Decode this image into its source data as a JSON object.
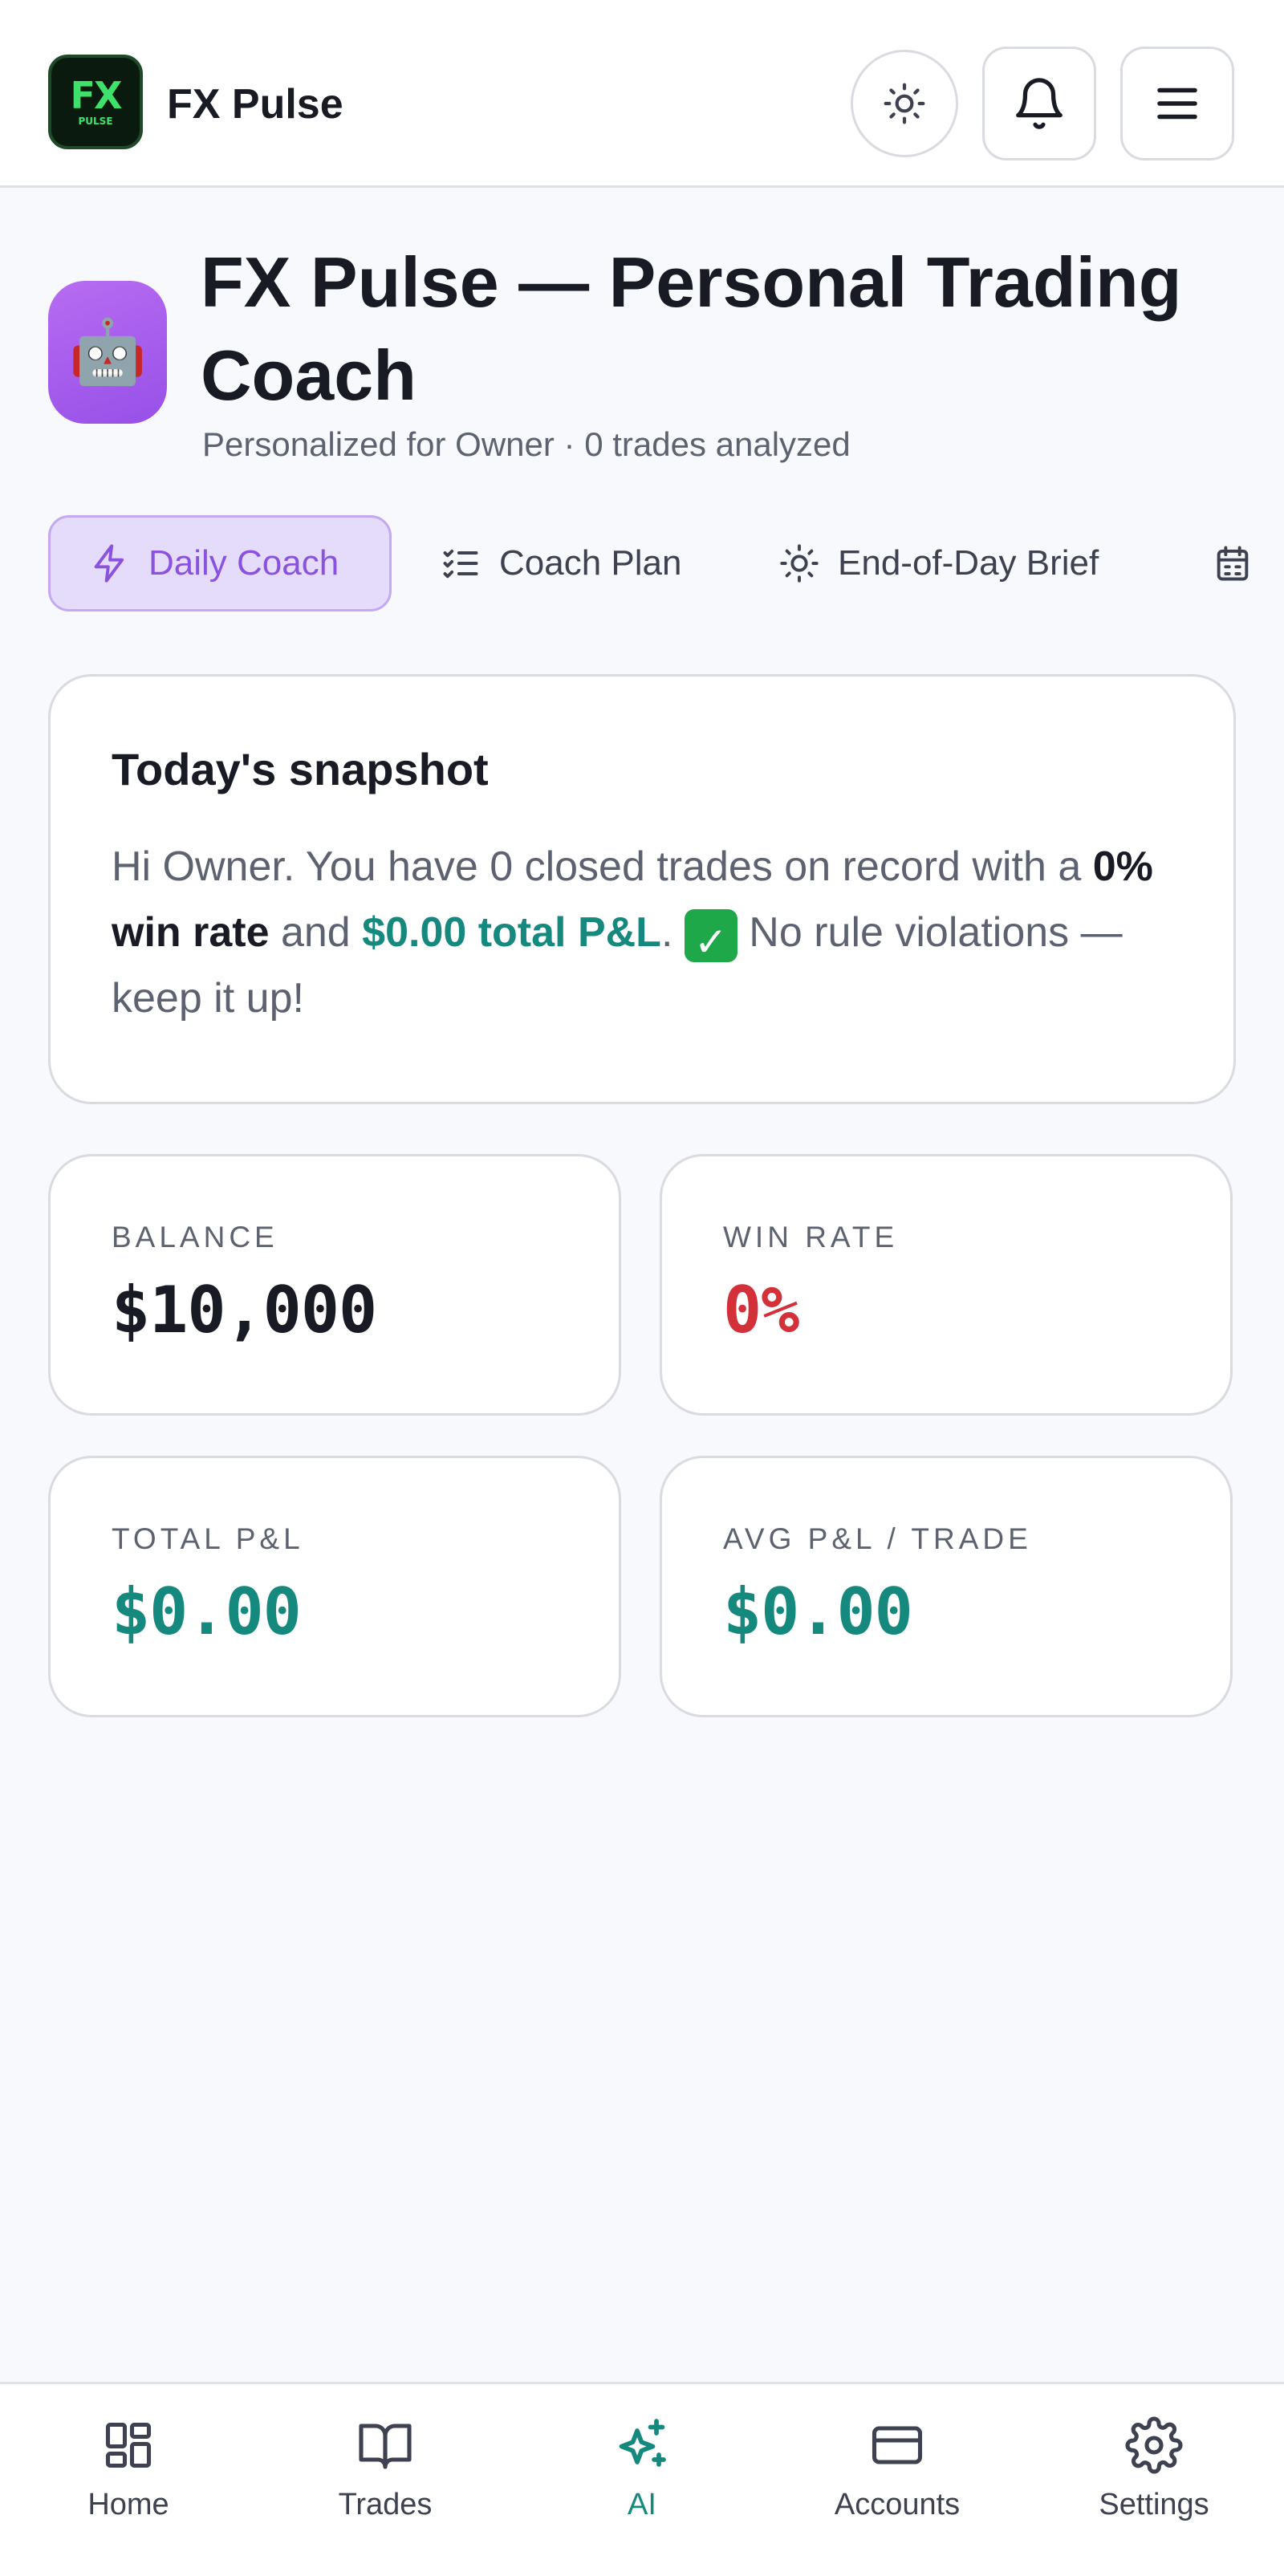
{
  "header": {
    "logo_text": "FX",
    "logo_subtext": "PULSE",
    "app_name": "FX Pulse",
    "icons": [
      "sun-icon",
      "bell-icon",
      "menu-icon"
    ]
  },
  "page": {
    "avatar_emoji": "🤖",
    "title": "FX Pulse — Personal Trading Coach",
    "subtitle": "Personalized for Owner · 0 trades analyzed"
  },
  "tabs": [
    {
      "label": "Daily Coach",
      "icon": "bolt-icon",
      "active": true
    },
    {
      "label": "Coach Plan",
      "icon": "checklist-icon",
      "active": false
    },
    {
      "label": "End-of-Day Brief",
      "icon": "sun-icon",
      "active": false
    },
    {
      "label": "",
      "icon": "calendar-icon",
      "active": false
    }
  ],
  "snapshot": {
    "title": "Today's snapshot",
    "text_1": "Hi Owner. You have 0 closed trades on record with a ",
    "win_rate_text": "0% win rate",
    "text_2": " and ",
    "pnl_text": "$0.00 total P&L",
    "text_3": ". ",
    "check": "✓",
    "text_4": " No rule violations — keep it up!"
  },
  "stats": {
    "balance": {
      "label": "BALANCE",
      "value": "$10,000",
      "color": "#181a24"
    },
    "win_rate": {
      "label": "WIN RATE",
      "value": "0%",
      "color": "#d3303a"
    },
    "total_pnl": {
      "label": "TOTAL P&L",
      "value": "$0.00",
      "color": "#16897f"
    },
    "avg_pnl": {
      "label": "AVG P&L / TRADE",
      "value": "$0.00",
      "color": "#16897f"
    }
  },
  "nav": [
    {
      "label": "Home",
      "icon": "grid-icon",
      "active": false
    },
    {
      "label": "Trades",
      "icon": "book-icon",
      "active": false
    },
    {
      "label": "AI",
      "icon": "sparkles-icon",
      "active": true
    },
    {
      "label": "Accounts",
      "icon": "card-icon",
      "active": false
    },
    {
      "label": "Settings",
      "icon": "gear-icon",
      "active": false
    }
  ],
  "colors": {
    "accent_purple": "#8a52df",
    "accent_teal": "#16897f",
    "negative_red": "#d3303a",
    "background": "#f8f9fc"
  }
}
